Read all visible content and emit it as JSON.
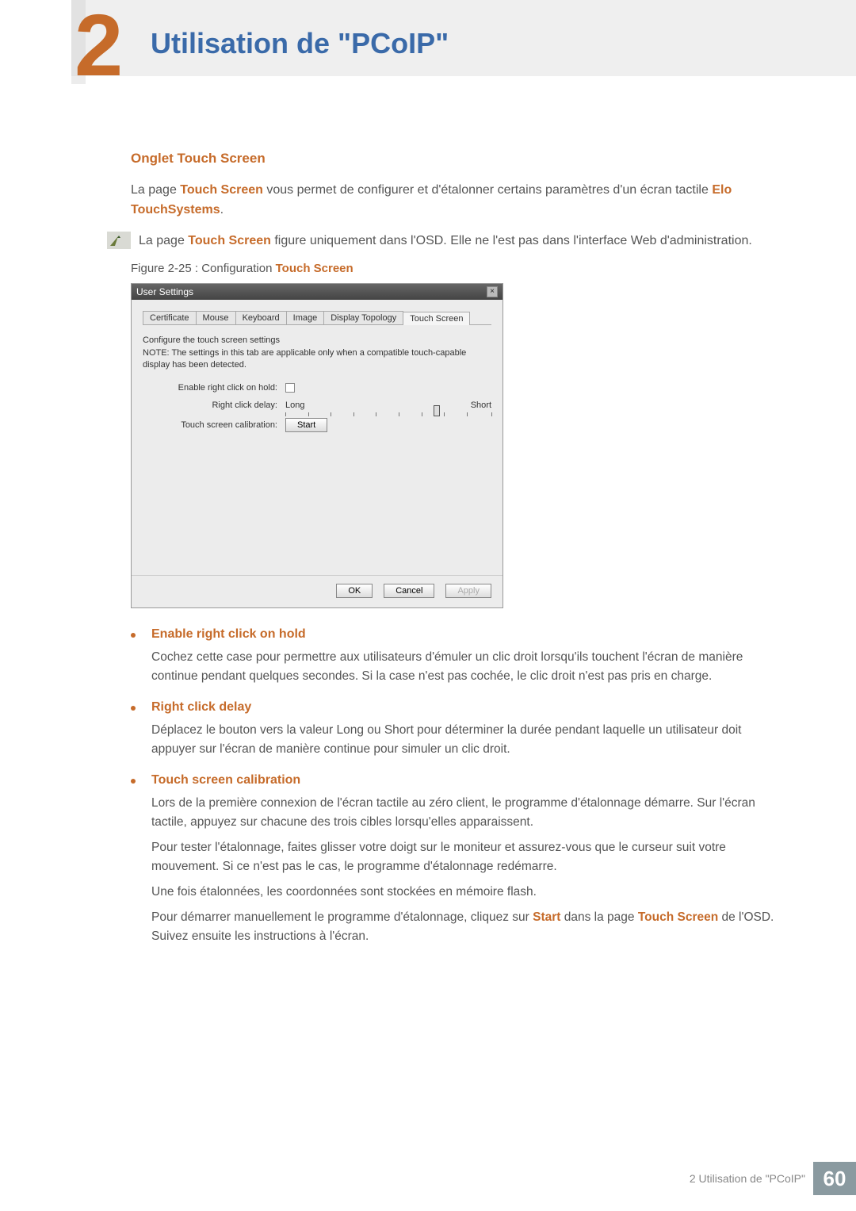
{
  "chapter": {
    "number": "2",
    "title": "Utilisation de \"PCoIP\""
  },
  "section": {
    "heading": "Onglet Touch Screen",
    "intro_pre": "La page ",
    "intro_b1": "Touch Screen",
    "intro_mid": " vous permet de configurer et d'étalonner certains paramètres d'un écran tactile ",
    "intro_b2": "Elo TouchSystems",
    "intro_post": ".",
    "note_pre": "La page ",
    "note_b": "Touch Screen",
    "note_post": " figure uniquement dans l'OSD. Elle ne l'est pas dans l'interface Web d'administration.",
    "fig_pre": "Figure 2-25 : Configuration ",
    "fig_b": "Touch Screen"
  },
  "window": {
    "title": "User Settings",
    "close": "×",
    "tabs": [
      "Certificate",
      "Mouse",
      "Keyboard",
      "Image",
      "Display Topology",
      "Touch Screen"
    ],
    "desc1": "Configure the touch screen settings",
    "desc2": "NOTE: The settings in this tab are applicable only when a compatible touch-capable display has been detected.",
    "row1_label": "Enable right click on hold:",
    "row2_label": "Right click delay:",
    "row2_long": "Long",
    "row2_short": "Short",
    "row3_label": "Touch screen calibration:",
    "row3_btn": "Start",
    "ok": "OK",
    "cancel": "Cancel",
    "apply": "Apply"
  },
  "bullets": [
    {
      "title": "Enable right click on hold",
      "paras": [
        "Cochez cette case pour permettre aux utilisateurs d'émuler un clic droit lorsqu'ils touchent l'écran de manière continue pendant quelques secondes. Si la case n'est pas cochée, le clic droit n'est pas pris en charge."
      ]
    },
    {
      "title": "Right click delay",
      "paras": [
        "Déplacez le bouton vers la valeur Long ou Short pour déterminer la durée pendant laquelle un utilisateur doit appuyer sur l'écran de manière continue pour simuler un clic droit."
      ]
    },
    {
      "title": "Touch screen calibration",
      "paras": [
        "Lors de la première connexion de l'écran tactile au zéro client, le programme d'étalonnage démarre. Sur l'écran tactile, appuyez sur chacune des trois cibles lorsqu'elles apparaissent.",
        "Pour tester l'étalonnage, faites glisser votre doigt sur le moniteur et assurez-vous que le curseur suit votre mouvement. Si ce n'est pas le cas, le programme d'étalonnage redémarre.",
        "Une fois étalonnées, les coordonnées sont stockées en mémoire flash."
      ],
      "final_pre": "Pour démarrer manuellement le programme d'étalonnage, cliquez sur ",
      "final_b1": "Start",
      "final_mid": " dans la page ",
      "final_b2": "Touch Screen",
      "final_post": " de l'OSD. Suivez ensuite les instructions à l'écran."
    }
  ],
  "footer": {
    "text": "2 Utilisation de \"PCoIP\"",
    "page": "60"
  }
}
